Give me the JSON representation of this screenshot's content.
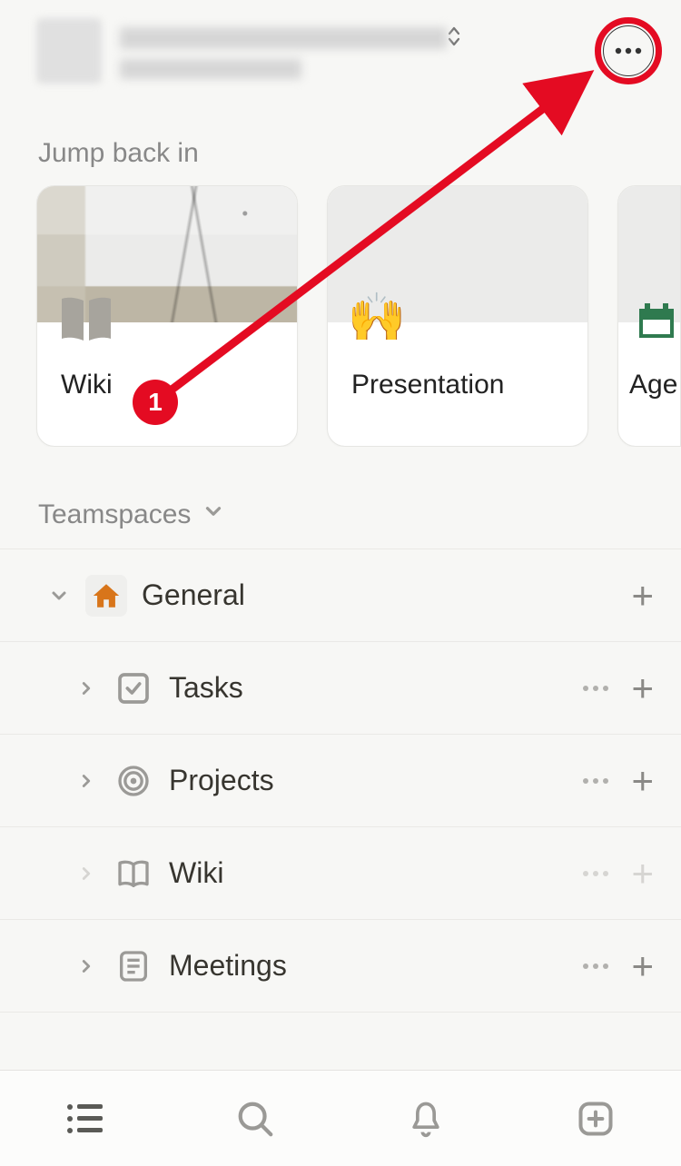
{
  "header": {
    "workspace_name": "",
    "workspace_subtitle": ""
  },
  "jump_back": {
    "title": "Jump back in",
    "cards": [
      {
        "icon": "book-icon",
        "title": "Wiki"
      },
      {
        "icon": "🙌",
        "title": "Presentation"
      },
      {
        "icon": "calendar-icon",
        "title": "Age"
      }
    ]
  },
  "teamspaces": {
    "label": "Teamspaces"
  },
  "tree": {
    "root": {
      "icon": "🏠",
      "label": "General"
    },
    "items": [
      {
        "icon": "check-square",
        "label": "Tasks"
      },
      {
        "icon": "target",
        "label": "Projects"
      },
      {
        "icon": "book-open",
        "label": "Wiki",
        "dim": true
      },
      {
        "icon": "doc",
        "label": "Meetings"
      }
    ]
  },
  "annotation": {
    "badge": "1"
  }
}
